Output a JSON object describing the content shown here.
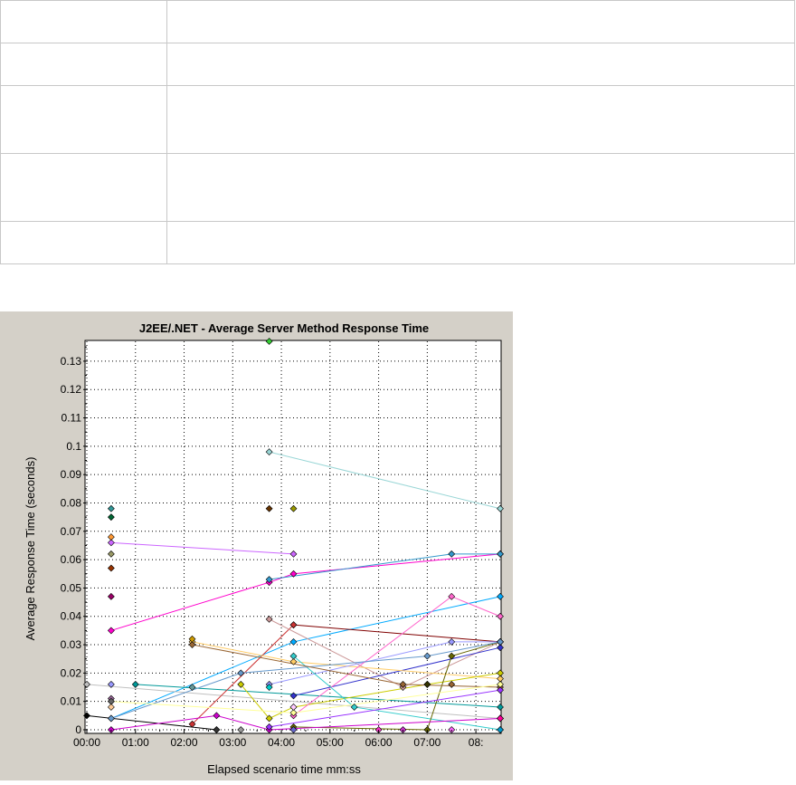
{
  "table": {
    "rows": [
      {
        "key": "",
        "value": ""
      },
      {
        "key": "",
        "value": ""
      },
      {
        "key": "",
        "value": ""
      },
      {
        "key": "",
        "value": ""
      },
      {
        "key": "",
        "value": ""
      }
    ]
  },
  "chart_data": {
    "type": "line",
    "title": "J2EE/.NET - Average Server Method Response Time",
    "xlabel": "Elapsed scenario time mm:ss",
    "ylabel": "Average Response Time (seconds)",
    "x_ticks": [
      "00:00",
      "01:00",
      "02:00",
      "03:00",
      "04:00",
      "05:00",
      "06:00",
      "07:00",
      "08:"
    ],
    "y_ticks": [
      "0",
      "0.01",
      "0.02",
      "0.03",
      "0.04",
      "0.05",
      "0.06",
      "0.07",
      "0.08",
      "0.09",
      "0.1",
      "0.11",
      "0.12",
      "0.13"
    ],
    "xlim_seconds": [
      0,
      510
    ],
    "ylim": [
      0,
      0.137
    ],
    "grid": true,
    "x_unit": "seconds",
    "series": [
      {
        "color": "#99d6d6",
        "points": [
          [
            225,
            0.098
          ],
          [
            510,
            0.078
          ]
        ]
      },
      {
        "color": "#cc66ff",
        "points": [
          [
            30,
            0.066
          ],
          [
            255,
            0.062
          ]
        ]
      },
      {
        "color": "#ff00cc",
        "points": [
          [
            30,
            0.035
          ],
          [
            225,
            0.052
          ],
          [
            255,
            0.055
          ],
          [
            510,
            0.062
          ]
        ]
      },
      {
        "color": "#3399cc",
        "points": [
          [
            225,
            0.053
          ],
          [
            450,
            0.062
          ],
          [
            510,
            0.062
          ]
        ]
      },
      {
        "color": "#00aaff",
        "points": [
          [
            30,
            0.004
          ],
          [
            255,
            0.031
          ],
          [
            510,
            0.047
          ]
        ]
      },
      {
        "color": "#800000",
        "points": [
          [
            255,
            0.037
          ],
          [
            510,
            0.031
          ]
        ]
      },
      {
        "color": "#c0c0c0",
        "points": [
          [
            0,
            0.016
          ],
          [
            510,
            0.004
          ]
        ]
      },
      {
        "color": "#009999",
        "points": [
          [
            60,
            0.016
          ],
          [
            510,
            0.008
          ]
        ]
      },
      {
        "color": "#cc3333",
        "points": [
          [
            130,
            0.002
          ],
          [
            255,
            0.037
          ]
        ]
      },
      {
        "color": "#cc9999",
        "points": [
          [
            225,
            0.039
          ],
          [
            390,
            0.015
          ],
          [
            510,
            0.031
          ]
        ]
      },
      {
        "color": "#000000",
        "points": [
          [
            0,
            0.005
          ],
          [
            160,
            0.0
          ]
        ]
      },
      {
        "color": "#3333cc",
        "points": [
          [
            255,
            0.012
          ],
          [
            510,
            0.029
          ]
        ]
      },
      {
        "color": "#ffcc66",
        "points": [
          [
            130,
            0.031
          ],
          [
            255,
            0.024
          ],
          [
            510,
            0.018
          ]
        ]
      },
      {
        "color": "#9999ff",
        "points": [
          [
            225,
            0.016
          ],
          [
            450,
            0.031
          ],
          [
            510,
            0.031
          ]
        ]
      },
      {
        "color": "#cccc00",
        "points": [
          [
            190,
            0.016
          ],
          [
            225,
            0.004
          ],
          [
            255,
            0.008
          ],
          [
            420,
            0.016
          ],
          [
            510,
            0.02
          ]
        ]
      },
      {
        "color": "#ff66cc",
        "points": [
          [
            255,
            0.005
          ],
          [
            450,
            0.047
          ],
          [
            510,
            0.04
          ]
        ]
      },
      {
        "color": "#33cccc",
        "points": [
          [
            255,
            0.026
          ],
          [
            330,
            0.008
          ],
          [
            510,
            0.0
          ]
        ]
      },
      {
        "color": "#666600",
        "points": [
          [
            255,
            0.001
          ],
          [
            420,
            0.0
          ],
          [
            450,
            0.026
          ],
          [
            510,
            0.031
          ]
        ]
      },
      {
        "color": "#6699cc",
        "points": [
          [
            30,
            0.004
          ],
          [
            190,
            0.02
          ],
          [
            420,
            0.026
          ],
          [
            510,
            0.031
          ]
        ]
      },
      {
        "color": "#cc00cc",
        "points": [
          [
            30,
            0.0
          ],
          [
            160,
            0.005
          ],
          [
            225,
            0.0
          ],
          [
            510,
            0.004
          ]
        ]
      },
      {
        "color": "#996633",
        "points": [
          [
            130,
            0.03
          ],
          [
            390,
            0.016
          ],
          [
            510,
            0.015
          ]
        ]
      },
      {
        "color": "#9933ff",
        "points": [
          [
            225,
            0.001
          ],
          [
            510,
            0.014
          ]
        ]
      },
      {
        "color": "#ffff99",
        "points": [
          [
            30,
            0.01
          ],
          [
            255,
            0.006
          ],
          [
            510,
            0.016
          ]
        ]
      }
    ],
    "scatter_points": [
      {
        "x": 225,
        "y": 0.137,
        "color": "#33cc33"
      },
      {
        "x": 30,
        "y": 0.078,
        "color": "#339999"
      },
      {
        "x": 30,
        "y": 0.075,
        "color": "#006633"
      },
      {
        "x": 30,
        "y": 0.068,
        "color": "#ff9933"
      },
      {
        "x": 30,
        "y": 0.062,
        "color": "#999966"
      },
      {
        "x": 30,
        "y": 0.057,
        "color": "#993300"
      },
      {
        "x": 30,
        "y": 0.047,
        "color": "#990066"
      },
      {
        "x": 225,
        "y": 0.078,
        "color": "#663300"
      },
      {
        "x": 255,
        "y": 0.078,
        "color": "#999900"
      },
      {
        "x": 30,
        "y": 0.016,
        "color": "#9999ff"
      },
      {
        "x": 30,
        "y": 0.011,
        "color": "#996699"
      },
      {
        "x": 30,
        "y": 0.01,
        "color": "#666666"
      },
      {
        "x": 30,
        "y": 0.008,
        "color": "#ffcc99"
      },
      {
        "x": 130,
        "y": 0.032,
        "color": "#cc9900"
      },
      {
        "x": 130,
        "y": 0.015,
        "color": "#669999"
      },
      {
        "x": 160,
        "y": 0.0,
        "color": "#333333"
      },
      {
        "x": 190,
        "y": 0.0,
        "color": "#999999"
      },
      {
        "x": 225,
        "y": 0.015,
        "color": "#00cccc"
      },
      {
        "x": 255,
        "y": 0.008,
        "color": "#ffccff"
      },
      {
        "x": 255,
        "y": 0.0,
        "color": "#6666cc"
      },
      {
        "x": 360,
        "y": 0.0,
        "color": "#ff33cc"
      },
      {
        "x": 390,
        "y": 0.0,
        "color": "#cc33cc"
      },
      {
        "x": 420,
        "y": 0.016,
        "color": "#333300"
      },
      {
        "x": 450,
        "y": 0.016,
        "color": "#996633"
      },
      {
        "x": 450,
        "y": 0.0,
        "color": "#ff66ff"
      },
      {
        "x": 510,
        "y": 0.004,
        "color": "#ff0099"
      },
      {
        "x": 510,
        "y": 0.0,
        "color": "#0099cc"
      }
    ]
  }
}
